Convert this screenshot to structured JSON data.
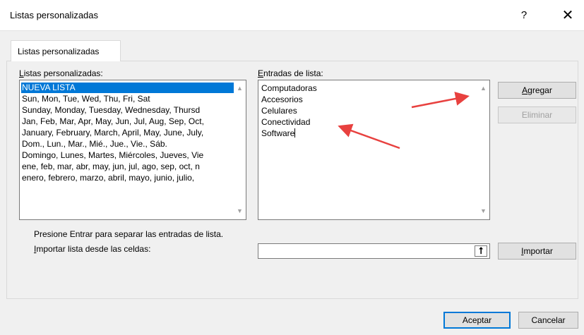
{
  "window": {
    "title": "Listas personalizadas",
    "help_glyph": "?",
    "close_glyph": "✕"
  },
  "tab": {
    "label": "Listas personalizadas"
  },
  "left_panel": {
    "label_prefix": "",
    "label_underlined": "L",
    "label_rest": "istas personalizadas:",
    "items": [
      "NUEVA LISTA",
      "Sun, Mon, Tue, Wed, Thu, Fri, Sat",
      "Sunday, Monday, Tuesday, Wednesday, Thursd",
      "Jan, Feb, Mar, Apr, May, Jun, Jul, Aug, Sep, Oct,",
      "January, February, March, April, May, June, July,",
      "Dom., Lun., Mar., Mié., Jue., Vie., Sáb.",
      "Domingo, Lunes, Martes, Miércoles, Jueves, Vie",
      "ene, feb, mar, abr, may, jun, jul, ago, sep, oct, n",
      "enero, febrero, marzo, abril, mayo, junio, julio,"
    ],
    "selected_index": 0
  },
  "right_panel": {
    "label_underlined": "E",
    "label_rest": "ntradas de lista:",
    "entries": [
      "Computadoras",
      "Accesorios",
      "Celulares",
      "Conectividad",
      "Software"
    ]
  },
  "buttons": {
    "agregar_u": "A",
    "agregar_rest": "gregar",
    "eliminar": "Eliminar",
    "importar_u": "I",
    "importar_rest": "mportar",
    "aceptar": "Aceptar",
    "cancelar": "Cancelar"
  },
  "hint": "Presione Entrar para separar las entradas de lista.",
  "import": {
    "label_underlined": "I",
    "label_rest": "mportar lista desde las celdas:",
    "value": "",
    "icon": "arrow-up-icon"
  },
  "colors": {
    "selection": "#0078d7",
    "annotation_arrow": "#e8413f"
  }
}
